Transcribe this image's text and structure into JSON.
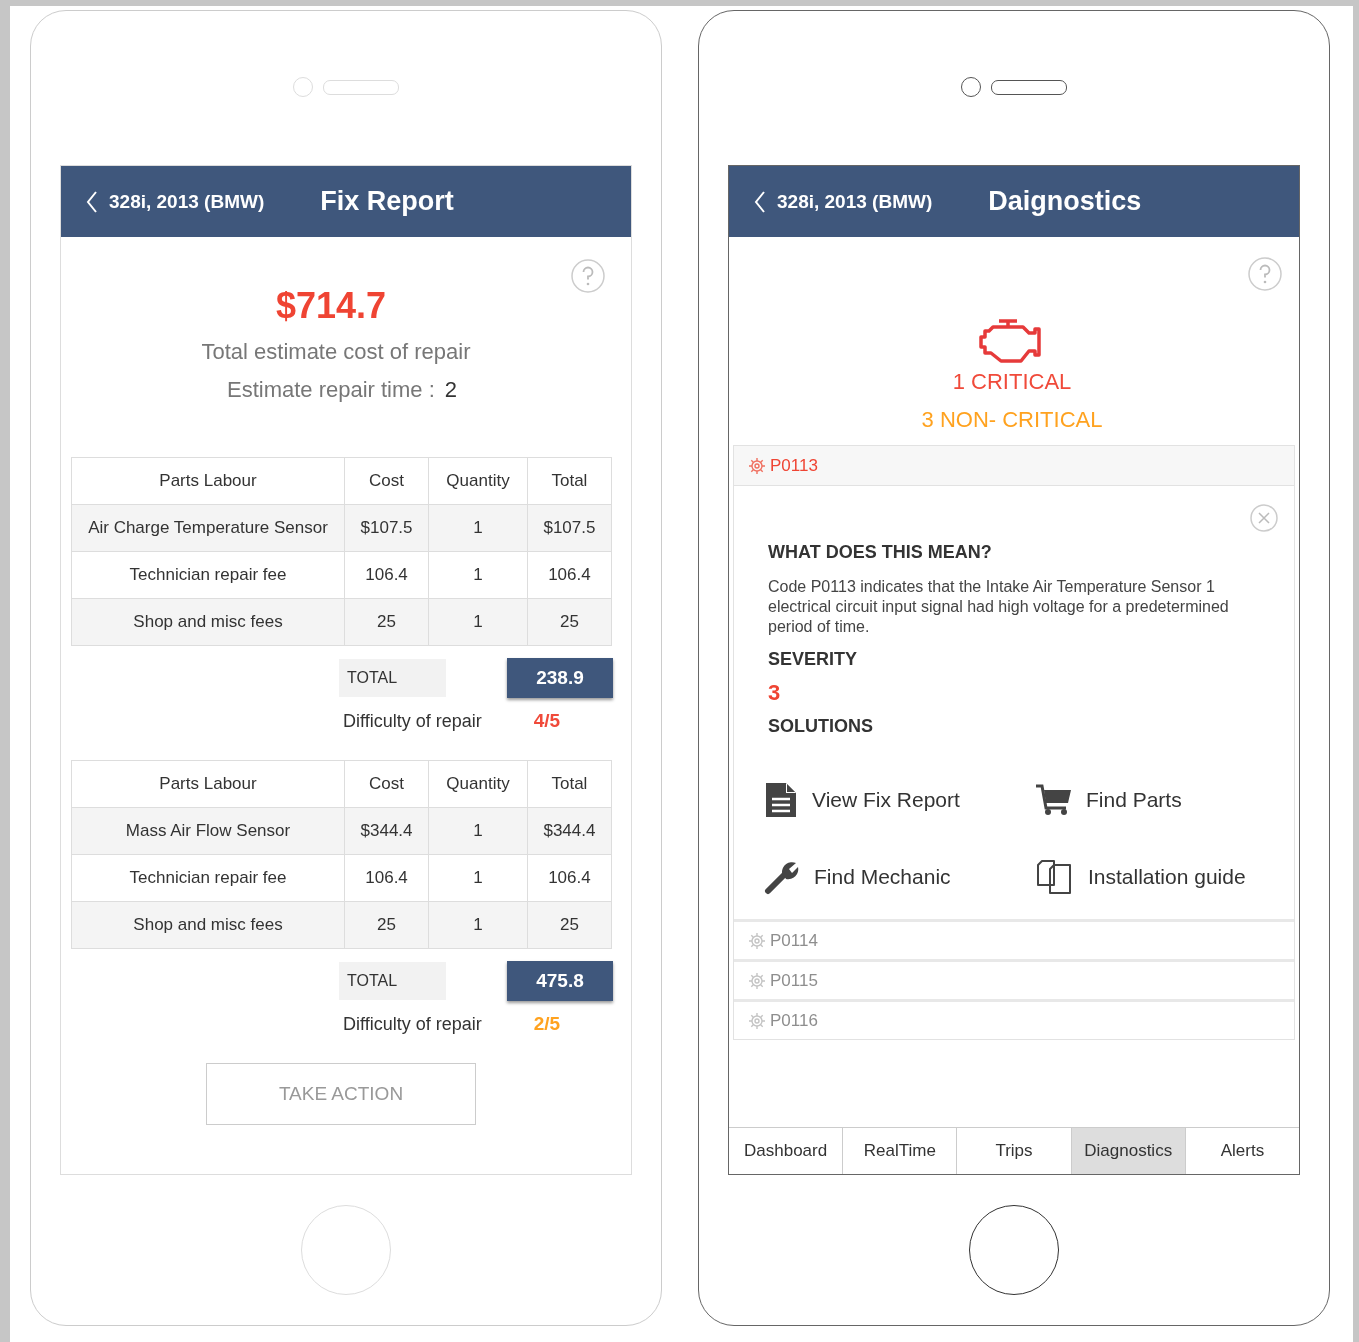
{
  "fix_report_screen": {
    "header": {
      "back": "328i, 2013 (BMW)",
      "title": "Fix Report"
    },
    "total_cost": "$714.7",
    "total_label": "Total estimate cost of repair",
    "time_label": "Estimate repair time :",
    "time_value": "2",
    "estimates": [
      {
        "columns": [
          "Parts Labour",
          "Cost",
          "Quantity",
          "Total"
        ],
        "rows": [
          [
            "Air Charge Temperature Sensor",
            "$107.5",
            "1",
            "$107.5"
          ],
          [
            "Technician repair fee",
            "106.4",
            "1",
            "106.4"
          ],
          [
            "Shop and misc fees",
            "25",
            "1",
            "25"
          ]
        ],
        "total_label": "TOTAL",
        "total": "238.9",
        "difficulty_label": "Difficulty of repair",
        "difficulty": "4/5",
        "color": "#f04a3a"
      },
      {
        "columns": [
          "Parts Labour",
          "Cost",
          "Quantity",
          "Total"
        ],
        "rows": [
          [
            "Mass Air Flow Sensor",
            "$344.4",
            "1",
            "$344.4"
          ],
          [
            "Technician repair fee",
            "106.4",
            "1",
            "106.4"
          ],
          [
            "Shop and misc fees",
            "25",
            "1",
            "25"
          ]
        ],
        "total_label": "TOTAL",
        "total": "475.8",
        "difficulty_label": "Difficulty of repair",
        "difficulty": "2/5",
        "color": "#ffa21f"
      }
    ],
    "action": "TAKE ACTION"
  },
  "diagnostics_screen": {
    "header": {
      "back": "328i, 2013 (BMW)",
      "title": "Daignostics"
    },
    "counts": [
      {
        "text": "1 CRITICAL",
        "color": "#f04a3a"
      },
      {
        "text": "3 NON- CRITICAL",
        "color": "#ffa21f"
      }
    ],
    "codes": [
      {
        "code": "P0113",
        "expanded": true,
        "meaning_title": "WHAT DOES THIS MEAN?",
        "meaning": "Code P0113 indicates that the Intake Air Temperature Sensor 1 electrical circuit input signal had high voltage for a predetermined period of time.",
        "severity_title": "SEVERITY",
        "severity": "3",
        "solutions_title": "SOLUTIONS",
        "solutions": [
          {
            "kind": "document",
            "label": "View Fix Report"
          },
          {
            "kind": "cart",
            "label": "Find Parts"
          },
          {
            "kind": "wrench",
            "label": "Find Mechanic"
          },
          {
            "kind": "copy",
            "label": "Installation guide"
          }
        ]
      },
      {
        "code": "P0114",
        "expanded": false
      },
      {
        "code": "P0115",
        "expanded": false
      },
      {
        "code": "P0116",
        "expanded": false
      }
    ],
    "tabs": [
      {
        "label": "Dashboard",
        "selected": false
      },
      {
        "label": "RealTime",
        "selected": false
      },
      {
        "label": "Trips",
        "selected": false
      },
      {
        "label": "Diagnostics",
        "selected": true
      },
      {
        "label": "Alerts",
        "selected": false
      }
    ]
  }
}
